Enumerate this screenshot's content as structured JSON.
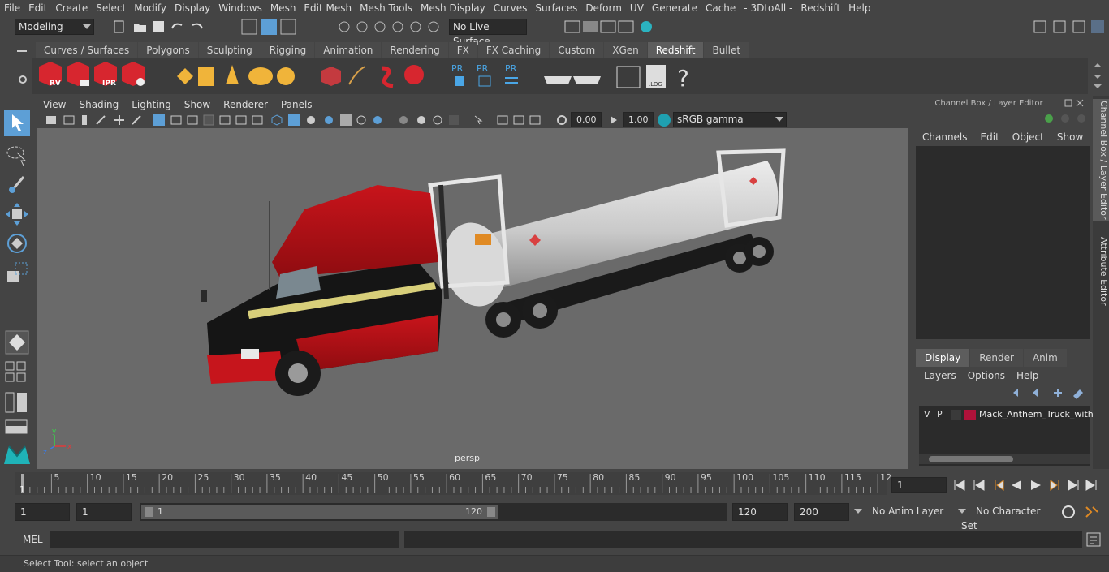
{
  "menu": [
    "File",
    "Edit",
    "Create",
    "Select",
    "Modify",
    "Display",
    "Windows",
    "Mesh",
    "Edit Mesh",
    "Mesh Tools",
    "Mesh Display",
    "Curves",
    "Surfaces",
    "Deform",
    "UV",
    "Generate",
    "Cache",
    "- 3DtoAll -",
    "Redshift",
    "Help"
  ],
  "statusline": {
    "mode": "Modeling",
    "live_surface": "No Live Surface"
  },
  "shelf": {
    "tabs": [
      "Curves / Surfaces",
      "Polygons",
      "Sculpting",
      "Rigging",
      "Animation",
      "Rendering",
      "FX",
      "FX Caching",
      "Custom",
      "XGen",
      "Redshift",
      "Bullet"
    ],
    "active": "Redshift",
    "btn_labels": {
      "rv": "RV",
      "ipr": "IPR",
      "pr1": "PR",
      "pr2": "PR",
      "pr3": "PR",
      "log": ".LOG",
      "help": "?"
    }
  },
  "viewport": {
    "menu": [
      "View",
      "Shading",
      "Lighting",
      "Show",
      "Renderer",
      "Panels"
    ],
    "exposure": "0.00",
    "gamma": "1.00",
    "colorspace": "sRGB gamma",
    "camera_label": "persp",
    "axis": {
      "x": "x",
      "y": "y",
      "z": "z"
    }
  },
  "channel_box": {
    "title": "Channel Box / Layer Editor",
    "menu": [
      "Channels",
      "Edit",
      "Object",
      "Show"
    ],
    "layer_tabs": [
      "Display",
      "Render",
      "Anim"
    ],
    "layer_active": "Display",
    "layer_menu": [
      "Layers",
      "Options",
      "Help"
    ],
    "layer": {
      "v": "V",
      "p": "P",
      "name": "Mack_Anthem_Truck_with_",
      "color": "#b0123a"
    }
  },
  "side_tabs": [
    "Channel Box / Layer Editor",
    "Attribute Editor"
  ],
  "timeline": {
    "ticks": [
      "5",
      "10",
      "15",
      "20",
      "25",
      "30",
      "35",
      "40",
      "45",
      "50",
      "55",
      "60",
      "65",
      "70",
      "75",
      "80",
      "85",
      "90",
      "95",
      "100",
      "105",
      "110",
      "115",
      "12"
    ],
    "start_label": "1",
    "current_frame": "1"
  },
  "range": {
    "start": "1",
    "playback_start": "1",
    "slider_start": "1",
    "slider_end": "120",
    "playback_end": "120",
    "end": "200",
    "anim_layer": "No Anim Layer",
    "character_set": "No Character Set"
  },
  "mel": {
    "label": "MEL"
  },
  "help_line": "Select Tool: select an object",
  "colors": {
    "accent": "#5d9fd6",
    "redshift_red": "#d7262f",
    "bg": "#444444",
    "viewport_bg": "#6a6a6a"
  }
}
